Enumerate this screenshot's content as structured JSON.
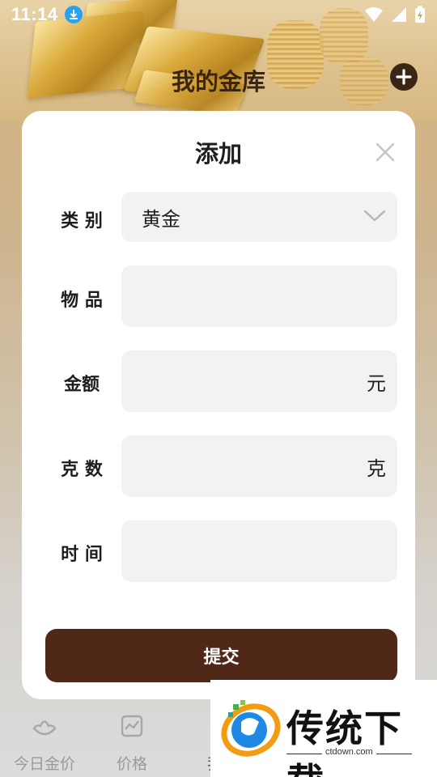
{
  "status_bar": {
    "time": "11:14",
    "icons": [
      "download-icon",
      "wifi-icon",
      "signal-icon",
      "battery-charging-icon"
    ]
  },
  "header": {
    "title": "我的金库",
    "add_icon": "plus-circle-icon"
  },
  "modal": {
    "title": "添加",
    "close_icon": "close-icon",
    "fields": {
      "category": {
        "label": "类 别",
        "value": "黄金",
        "icon": "chevron-down-icon"
      },
      "item": {
        "label": "物 品",
        "value": ""
      },
      "amount": {
        "label": "金额",
        "value": "",
        "unit": "元"
      },
      "grams": {
        "label": "克 数",
        "value": "",
        "unit": "克"
      },
      "time": {
        "label": "时 间",
        "value": ""
      }
    },
    "submit_label": "提交"
  },
  "bottom_nav": {
    "items": [
      {
        "label": "今日金价",
        "icon": "ingot-icon"
      },
      {
        "label": "价格",
        "icon": "chart-icon"
      },
      {
        "label": "我的",
        "icon": "vault-icon"
      }
    ]
  },
  "watermark": {
    "text": "传统下载",
    "url": "ctdown.com"
  },
  "colors": {
    "accent": "#4f2818",
    "field_bg": "#f3f2f1",
    "download_badge": "#29a3f0"
  }
}
